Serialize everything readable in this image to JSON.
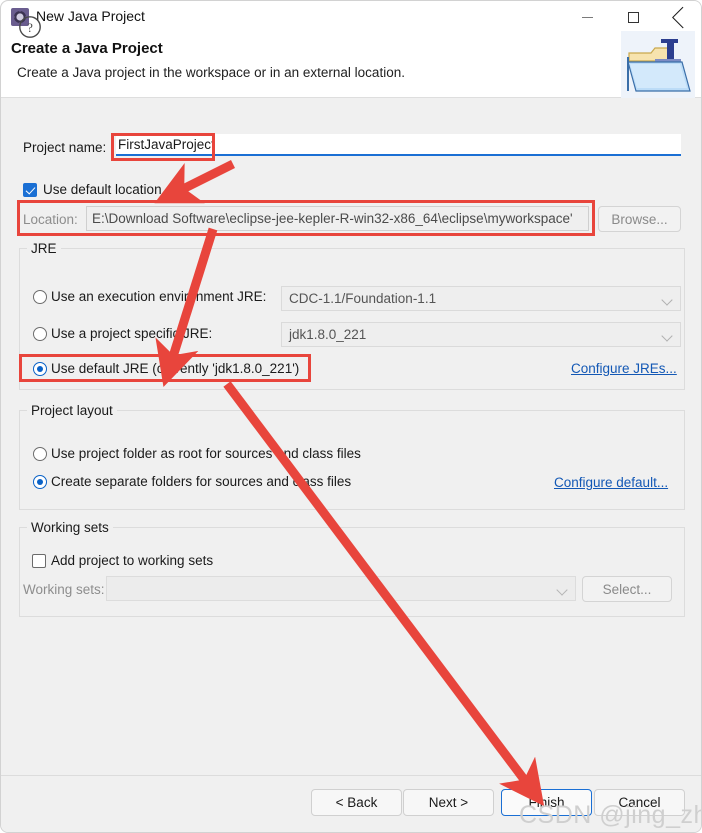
{
  "window": {
    "title": "New Java Project",
    "icon": "java-project-icon",
    "controls": {
      "minimize": "minimize-icon",
      "maximize": "maximize-icon",
      "close": "close-icon"
    }
  },
  "header": {
    "title": "Create a Java Project",
    "subtitle": "Create a Java project in the workspace or in an external location.",
    "icon": "java-folder-icon"
  },
  "project_name": {
    "label": "Project name:",
    "value": "FirstJavaProject",
    "placeholder": ""
  },
  "location": {
    "use_default_label": "Use default location",
    "use_default_checked": true,
    "label": "Location:",
    "value": "E:\\Download Software\\eclipse-jee-kepler-R-win32-x86_64\\eclipse\\myworkspace'",
    "browse_label": "Browse..."
  },
  "jre": {
    "group_title": "JRE",
    "options": [
      {
        "label": "Use an execution environment JRE:",
        "selected": false,
        "combo_value": "CDC-1.1/Foundation-1.1"
      },
      {
        "label": "Use a project specific JRE:",
        "selected": false,
        "combo_value": "jdk1.8.0_221"
      },
      {
        "label": "Use default JRE (currently 'jdk1.8.0_221')",
        "selected": true,
        "combo_value": ""
      }
    ],
    "configure_link": "Configure JREs..."
  },
  "project_layout": {
    "group_title": "Project layout",
    "options": [
      {
        "label": "Use project folder as root for sources and class files",
        "selected": false
      },
      {
        "label": "Create separate folders for sources and class files",
        "selected": true
      }
    ],
    "configure_link": "Configure default..."
  },
  "working_sets": {
    "group_title": "Working sets",
    "add_label": "Add project to working sets",
    "add_checked": false,
    "label": "Working sets:",
    "value": "",
    "select_label": "Select..."
  },
  "footer": {
    "help_icon": "help-icon",
    "back_label": "< Back",
    "next_label": "Next >",
    "finish_label": "Finish",
    "cancel_label": "Cancel"
  },
  "watermark": "CSDN @jing_zhong",
  "annotations": {
    "accent_color": "#e8453c",
    "highlight_boxes": [
      "project-name-field",
      "location-field",
      "use-default-jre-option"
    ],
    "arrows": [
      "project-name-to-location",
      "location-to-default-jre",
      "default-jre-to-finish"
    ]
  }
}
